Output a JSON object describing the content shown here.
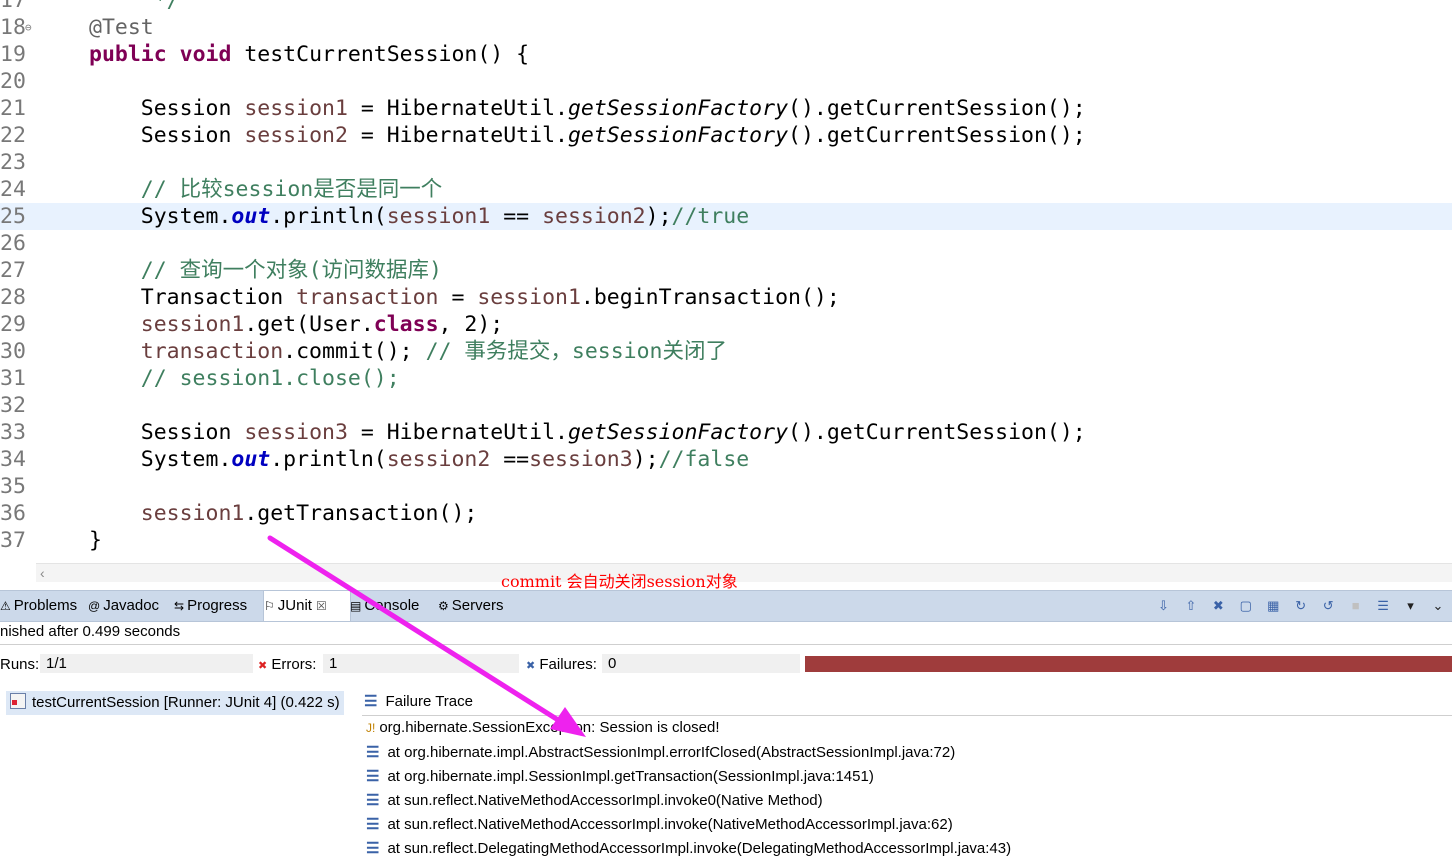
{
  "editor": {
    "partial_top": {
      "number": "17",
      "code": "     */"
    },
    "lines": [
      {
        "number": "18",
        "fold": true,
        "segments": [
          {
            "t": "@Test",
            "c": "ann"
          }
        ]
      },
      {
        "number": "19",
        "segments": [
          {
            "t": "public",
            "c": "kw"
          },
          {
            "t": " "
          },
          {
            "t": "void",
            "c": "kw"
          },
          {
            "t": " testCurrentSession() {"
          }
        ]
      },
      {
        "number": "20",
        "segments": []
      },
      {
        "number": "21",
        "segments": [
          {
            "t": "    Session "
          },
          {
            "t": "session1",
            "c": "var"
          },
          {
            "t": " = HibernateUtil."
          },
          {
            "t": "getSessionFactory",
            "c": "ital"
          },
          {
            "t": "().getCurrentSession();"
          }
        ]
      },
      {
        "number": "22",
        "segments": [
          {
            "t": "    Session "
          },
          {
            "t": "session2",
            "c": "var"
          },
          {
            "t": " = HibernateUtil."
          },
          {
            "t": "getSessionFactory",
            "c": "ital"
          },
          {
            "t": "().getCurrentSession();"
          }
        ]
      },
      {
        "number": "23",
        "segments": []
      },
      {
        "number": "24",
        "segments": [
          {
            "t": "    // 比较session是否是同一个",
            "c": "cmt"
          }
        ]
      },
      {
        "number": "25",
        "current": true,
        "segments": [
          {
            "t": "    System."
          },
          {
            "t": "out",
            "c": "fld"
          },
          {
            "t": ".println("
          },
          {
            "t": "session1",
            "c": "var"
          },
          {
            "t": " == "
          },
          {
            "t": "session2",
            "c": "var"
          },
          {
            "t": ");"
          },
          {
            "t": "//true",
            "c": "cmt"
          }
        ]
      },
      {
        "number": "26",
        "segments": []
      },
      {
        "number": "27",
        "segments": [
          {
            "t": "    // 查询一个对象(访问数据库)",
            "c": "cmt"
          }
        ]
      },
      {
        "number": "28",
        "segments": [
          {
            "t": "    Transaction "
          },
          {
            "t": "transaction",
            "c": "var"
          },
          {
            "t": " = "
          },
          {
            "t": "session1",
            "c": "var"
          },
          {
            "t": ".beginTransaction();"
          }
        ]
      },
      {
        "number": "29",
        "segments": [
          {
            "t": "    "
          },
          {
            "t": "session1",
            "c": "var"
          },
          {
            "t": ".get(User."
          },
          {
            "t": "class",
            "c": "kw"
          },
          {
            "t": ", 2);"
          }
        ]
      },
      {
        "number": "30",
        "segments": [
          {
            "t": "    "
          },
          {
            "t": "transaction",
            "c": "var"
          },
          {
            "t": ".commit(); "
          },
          {
            "t": "// 事务提交，session关闭了",
            "c": "cmt"
          }
        ]
      },
      {
        "number": "31",
        "segments": [
          {
            "t": "    // session1.close();",
            "c": "cmt"
          }
        ]
      },
      {
        "number": "32",
        "segments": []
      },
      {
        "number": "33",
        "segments": [
          {
            "t": "    Session "
          },
          {
            "t": "session3",
            "c": "var"
          },
          {
            "t": " = HibernateUtil."
          },
          {
            "t": "getSessionFactory",
            "c": "ital"
          },
          {
            "t": "().getCurrentSession();"
          }
        ]
      },
      {
        "number": "34",
        "segments": [
          {
            "t": "    System."
          },
          {
            "t": "out",
            "c": "fld"
          },
          {
            "t": ".println("
          },
          {
            "t": "session2",
            "c": "var"
          },
          {
            "t": " =="
          },
          {
            "t": "session3",
            "c": "var"
          },
          {
            "t": ");"
          },
          {
            "t": "//false",
            "c": "cmt"
          }
        ]
      },
      {
        "number": "35",
        "segments": []
      },
      {
        "number": "36",
        "segments": [
          {
            "t": "    "
          },
          {
            "t": "session1",
            "c": "var"
          },
          {
            "t": ".getTransaction();"
          }
        ]
      },
      {
        "number": "37",
        "segments": [
          {
            "t": "}"
          }
        ]
      }
    ]
  },
  "annotation_text": "commit 会自动关闭session对象",
  "annotation_color": "#ff0000",
  "arrow_color": "#ee22ee",
  "tabs": [
    {
      "label": "Problems",
      "icon": "problems-icon",
      "glyph": "⚠"
    },
    {
      "label": "Javadoc",
      "icon": "javadoc-icon",
      "glyph": "@"
    },
    {
      "label": "Progress",
      "icon": "progress-icon",
      "glyph": "⇆"
    },
    {
      "label": "JUnit",
      "icon": "junit-icon",
      "glyph": "⚐",
      "active": true
    },
    {
      "label": "Console",
      "icon": "console-icon",
      "glyph": "▤"
    },
    {
      "label": "Servers",
      "icon": "servers-icon",
      "glyph": "⚙"
    }
  ],
  "junit": {
    "status": "nished after 0.499 seconds",
    "runs_label": "Runs:",
    "runs_value": "1/1",
    "errors_label": "Errors:",
    "errors_value": "1",
    "failures_label": "Failures:",
    "failures_value": "0",
    "progress_color": "#9f3c3c",
    "test_item": "testCurrentSession [Runner: JUnit 4] (0.422 s)",
    "trace_header": "Failure Trace",
    "trace": [
      "org.hibernate.SessionException: Session is closed!",
      "at org.hibernate.impl.AbstractSessionImpl.errorIfClosed(AbstractSessionImpl.java:72)",
      "at org.hibernate.impl.SessionImpl.getTransaction(SessionImpl.java:1451)",
      "at sun.reflect.NativeMethodAccessorImpl.invoke0(Native Method)",
      "at sun.reflect.NativeMethodAccessorImpl.invoke(NativeMethodAccessorImpl.java:62)",
      "at sun.reflect.DelegatingMethodAccessorImpl.invoke(DelegatingMethodAccessorImpl.java:43)"
    ]
  }
}
